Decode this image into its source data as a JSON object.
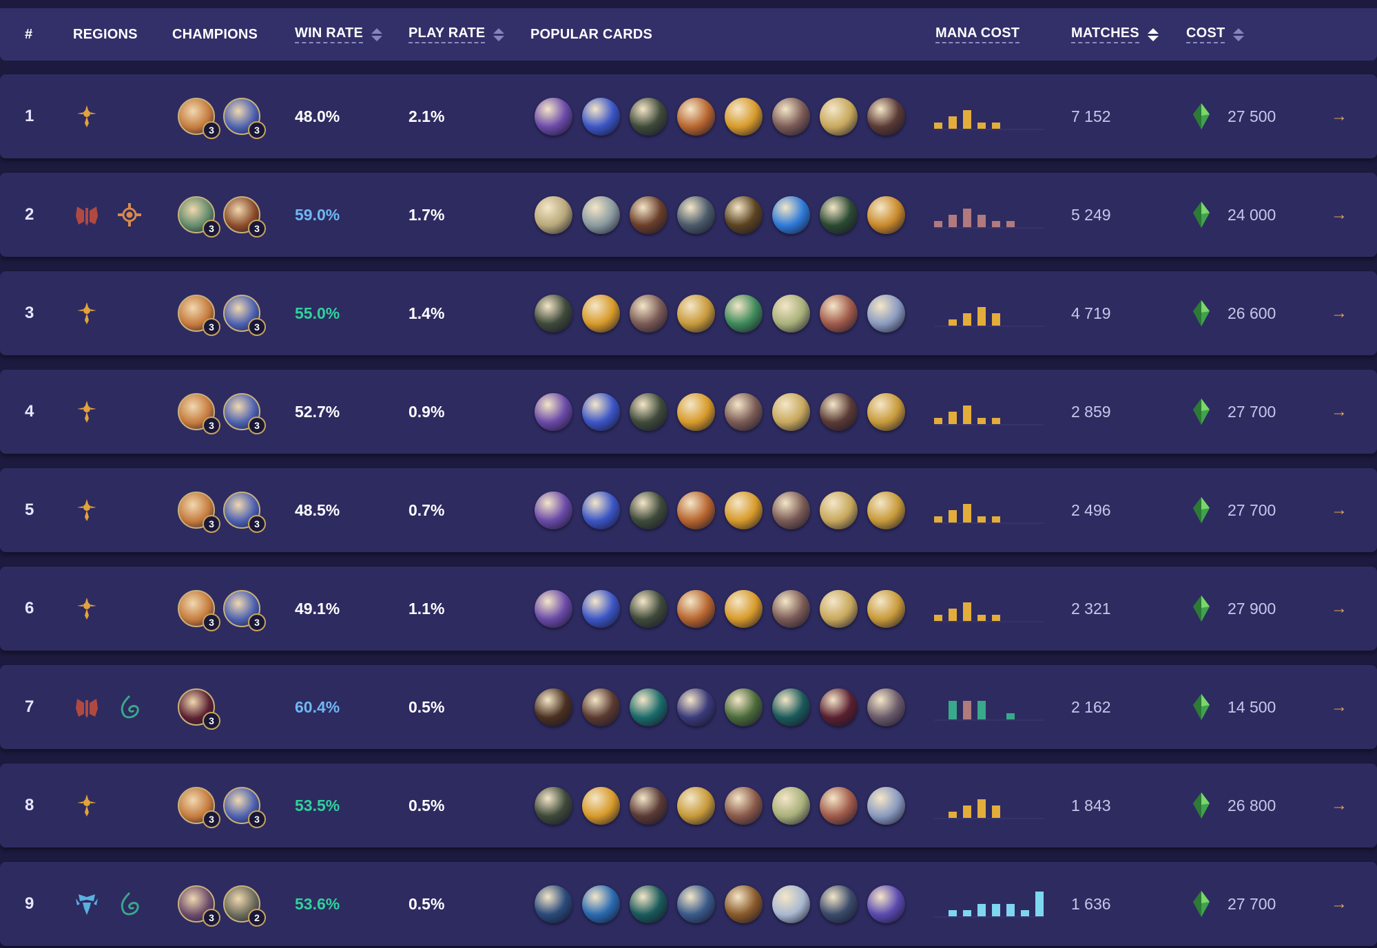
{
  "colors": {
    "win_blue": "#6fb8f2",
    "win_green": "#2fd39a",
    "win_white": "#ffffff",
    "mana_gold": "#e3ad3c",
    "mana_pink": "#b07a7e",
    "mana_cyan": "#7fd6f0",
    "gem_green": "#3fa34d"
  },
  "header": {
    "rank": "#",
    "regions": "REGIONS",
    "champions": "CHAMPIONS",
    "win_rate": "WIN RATE",
    "play_rate": "PLAY RATE",
    "popular_cards": "POPULAR CARDS",
    "mana_cost": "MANA COST",
    "matches": "MATCHES",
    "cost": "COST"
  },
  "rows": [
    {
      "rank": "1",
      "regions": [
        "shurima-icon"
      ],
      "champions": [
        {
          "icon": "champion-fire-icon",
          "count": "3",
          "color": "#c57a3c"
        },
        {
          "icon": "champion-blue-hood-icon",
          "count": "3",
          "color": "#4a5fb0"
        }
      ],
      "win_rate": "48.0%",
      "win_color": "white",
      "play_rate": "2.1%",
      "cards": [
        "#6a4aa8",
        "#3b55c6",
        "#3e4a3a",
        "#b7652e",
        "#d79a2a",
        "#7a5a55",
        "#c7a85c",
        "#5a3a35"
      ],
      "mana": [
        1,
        2,
        3,
        1,
        1,
        0
      ],
      "mana_color": "gold",
      "matches": "7 152",
      "cost": "27 500"
    },
    {
      "rank": "2",
      "regions": [
        "noxus-icon",
        "bilgewater-icon"
      ],
      "champions": [
        {
          "icon": "champion-green-icon",
          "count": "3",
          "color": "#5f8a6a"
        },
        {
          "icon": "champion-fire-mage-icon",
          "count": "3",
          "color": "#8a4a2a"
        }
      ],
      "win_rate": "59.0%",
      "win_color": "blue",
      "play_rate": "1.7%",
      "cards": [
        "#b8a87a",
        "#8a9aa0",
        "#6a3e2a",
        "#4a5a6a",
        "#5a4320",
        "#2e7ad8",
        "#2a4a32",
        "#c98a2a"
      ],
      "mana": [
        1,
        2,
        3,
        2,
        1,
        1
      ],
      "mana_color": "pink",
      "matches": "5 249",
      "cost": "24 000"
    },
    {
      "rank": "3",
      "regions": [
        "shurima-icon"
      ],
      "champions": [
        {
          "icon": "champion-fire-icon",
          "count": "3",
          "color": "#c57a3c"
        },
        {
          "icon": "champion-blue-hood-icon",
          "count": "3",
          "color": "#4a5fb0"
        }
      ],
      "win_rate": "55.0%",
      "win_color": "green",
      "play_rate": "1.4%",
      "cards": [
        "#3e4a3a",
        "#d79a2a",
        "#7a5a55",
        "#c79a3a",
        "#3e8a5a",
        "#a8b07a",
        "#a05a4a",
        "#8a9ac0"
      ],
      "mana": [
        0,
        1,
        2,
        3,
        2,
        0
      ],
      "mana_color": "gold",
      "matches": "4 719",
      "cost": "26 600"
    },
    {
      "rank": "4",
      "regions": [
        "shurima-icon"
      ],
      "champions": [
        {
          "icon": "champion-fire-icon",
          "count": "3",
          "color": "#c57a3c"
        },
        {
          "icon": "champion-blue-hood-icon",
          "count": "3",
          "color": "#4a5fb0"
        }
      ],
      "win_rate": "52.7%",
      "win_color": "white",
      "play_rate": "0.9%",
      "cards": [
        "#6a4aa8",
        "#3b55c6",
        "#3e4a3a",
        "#d79a2a",
        "#7a5a55",
        "#c7a85c",
        "#5a3a35",
        "#c79a3a"
      ],
      "mana": [
        1,
        2,
        3,
        1,
        1,
        0
      ],
      "mana_color": "gold",
      "matches": "2 859",
      "cost": "27 700"
    },
    {
      "rank": "5",
      "regions": [
        "shurima-icon"
      ],
      "champions": [
        {
          "icon": "champion-fire-icon",
          "count": "3",
          "color": "#c57a3c"
        },
        {
          "icon": "champion-blue-hood-icon",
          "count": "3",
          "color": "#4a5fb0"
        }
      ],
      "win_rate": "48.5%",
      "win_color": "white",
      "play_rate": "0.7%",
      "cards": [
        "#6a4aa8",
        "#3b55c6",
        "#3e4a3a",
        "#b7652e",
        "#d79a2a",
        "#7a5a55",
        "#c7a85c",
        "#c79a3a"
      ],
      "mana": [
        1,
        2,
        3,
        1,
        1,
        0
      ],
      "mana_color": "gold",
      "matches": "2 496",
      "cost": "27 700"
    },
    {
      "rank": "6",
      "regions": [
        "shurima-icon"
      ],
      "champions": [
        {
          "icon": "champion-fire-icon",
          "count": "3",
          "color": "#c57a3c"
        },
        {
          "icon": "champion-blue-hood-icon",
          "count": "3",
          "color": "#4a5fb0"
        }
      ],
      "win_rate": "49.1%",
      "win_color": "white",
      "play_rate": "1.1%",
      "cards": [
        "#6a4aa8",
        "#3b55c6",
        "#3e4a3a",
        "#b7652e",
        "#d79a2a",
        "#7a5a55",
        "#c7a85c",
        "#c79a3a"
      ],
      "mana": [
        1,
        2,
        3,
        1,
        1,
        0
      ],
      "mana_color": "gold",
      "matches": "2 321",
      "cost": "27 900"
    },
    {
      "rank": "7",
      "regions": [
        "noxus-icon",
        "shadow-isles-icon"
      ],
      "champions": [
        {
          "icon": "champion-dark-red-icon",
          "count": "3",
          "color": "#5a2030"
        }
      ],
      "win_rate": "60.4%",
      "win_color": "blue",
      "play_rate": "0.5%",
      "cards": [
        "#4a3020",
        "#5a3a30",
        "#1a6a6a",
        "#3a3a7a",
        "#4a6a3a",
        "#1a5a5a",
        "#5a2030",
        "#6a5a6a"
      ],
      "mana": [
        0,
        3,
        3,
        3,
        0,
        1
      ],
      "mana_color": "mixed",
      "matches": "2 162",
      "cost": "14 500"
    },
    {
      "rank": "8",
      "regions": [
        "shurima-icon"
      ],
      "champions": [
        {
          "icon": "champion-fire-icon",
          "count": "3",
          "color": "#c57a3c"
        },
        {
          "icon": "champion-blue-hood-icon",
          "count": "3",
          "color": "#4a5fb0"
        }
      ],
      "win_rate": "53.5%",
      "win_color": "green",
      "play_rate": "0.5%",
      "cards": [
        "#3e4a3a",
        "#d79a2a",
        "#5a3a35",
        "#c79a3a",
        "#8a5a4a",
        "#a8b07a",
        "#a05a4a",
        "#8a9ac0"
      ],
      "mana": [
        0,
        1,
        2,
        3,
        2,
        0
      ],
      "mana_color": "gold",
      "matches": "1 843",
      "cost": "26 800"
    },
    {
      "rank": "9",
      "regions": [
        "freljord-icon",
        "shadow-isles-icon"
      ],
      "champions": [
        {
          "icon": "champion-icy-icon",
          "count": "3",
          "color": "#6a4a6a"
        },
        {
          "icon": "champion-grey-icon",
          "count": "2",
          "color": "#6a6a5a"
        }
      ],
      "win_rate": "53.6%",
      "win_color": "green",
      "play_rate": "0.5%",
      "cards": [
        "#2a4a7a",
        "#2a6ab0",
        "#1a5a5a",
        "#3a5a8a",
        "#8a5a2a",
        "#a8b8d0",
        "#3a4a6a",
        "#5a4ab0"
      ],
      "mana": [
        0,
        1,
        1,
        2,
        2,
        2,
        1,
        4
      ],
      "mana_color": "cyan",
      "matches": "1 636",
      "cost": "27 700"
    }
  ]
}
